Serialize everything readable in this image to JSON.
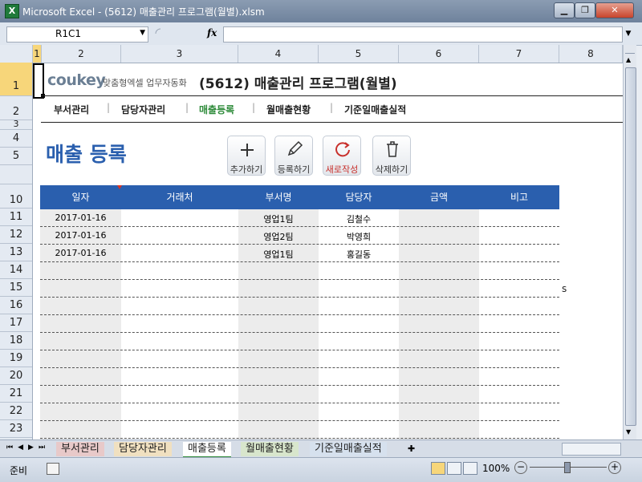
{
  "window": {
    "title": "Microsoft Excel - (5612) 매출관리 프로그램(월별).xlsm",
    "app_icon": "X",
    "min_symbol": "▁",
    "restore_symbol": "❐",
    "close_symbol": "✕",
    "help_symbol": "?",
    "ribbon_toggle": "^"
  },
  "formula_bar": {
    "name_box": "R1C1",
    "fx": "fx",
    "value": ""
  },
  "columns": [
    "1",
    "2",
    "3",
    "4",
    "5",
    "6",
    "7",
    "8"
  ],
  "rows": [
    "1",
    "2",
    "3",
    "4",
    "5",
    "10",
    "11",
    "12",
    "13",
    "14",
    "15",
    "16",
    "17",
    "18",
    "19",
    "20",
    "21",
    "22",
    "23"
  ],
  "brand": {
    "logo": "coukey",
    "tagline": "맞춤형엑셀 업무자동화",
    "program_title": "(5612) 매출관리 프로그램(월별)"
  },
  "menu": [
    "부서관리",
    "담당자관리",
    "매출등록",
    "월매출현황",
    "기준일매출실적"
  ],
  "menu_active_index": 2,
  "page_title": "매출 등록",
  "actions": [
    {
      "label": "추가하기",
      "icon": "plus-icon"
    },
    {
      "label": "등록하기",
      "icon": "pencil-icon"
    },
    {
      "label": "새로작성",
      "icon": "refresh-icon"
    },
    {
      "label": "삭제하기",
      "icon": "trash-icon"
    }
  ],
  "table": {
    "headers": [
      "일자",
      "거래처",
      "부서명",
      "담당자",
      "금액",
      "비고"
    ],
    "rows": [
      [
        "2017-01-16",
        "",
        "영업1팀",
        "김철수",
        "",
        ""
      ],
      [
        "2017-01-16",
        "",
        "영업2팀",
        "박영희",
        "",
        ""
      ],
      [
        "2017-01-16",
        "",
        "영업1팀",
        "홍길동",
        "",
        ""
      ]
    ]
  },
  "stray_cell_text": "s",
  "sheet_tabs": [
    "부서관리",
    "담당자관리",
    "매출등록",
    "월매출현황",
    "기준일매출실적"
  ],
  "active_tab_index": 2,
  "status": {
    "mode": "준비",
    "zoom": "100%"
  },
  "colors": {
    "header_blue": "#2a5fae",
    "title_blue": "#2a5fae",
    "menu_active": "#2e8b3a",
    "refresh_red": "#c8302c"
  }
}
